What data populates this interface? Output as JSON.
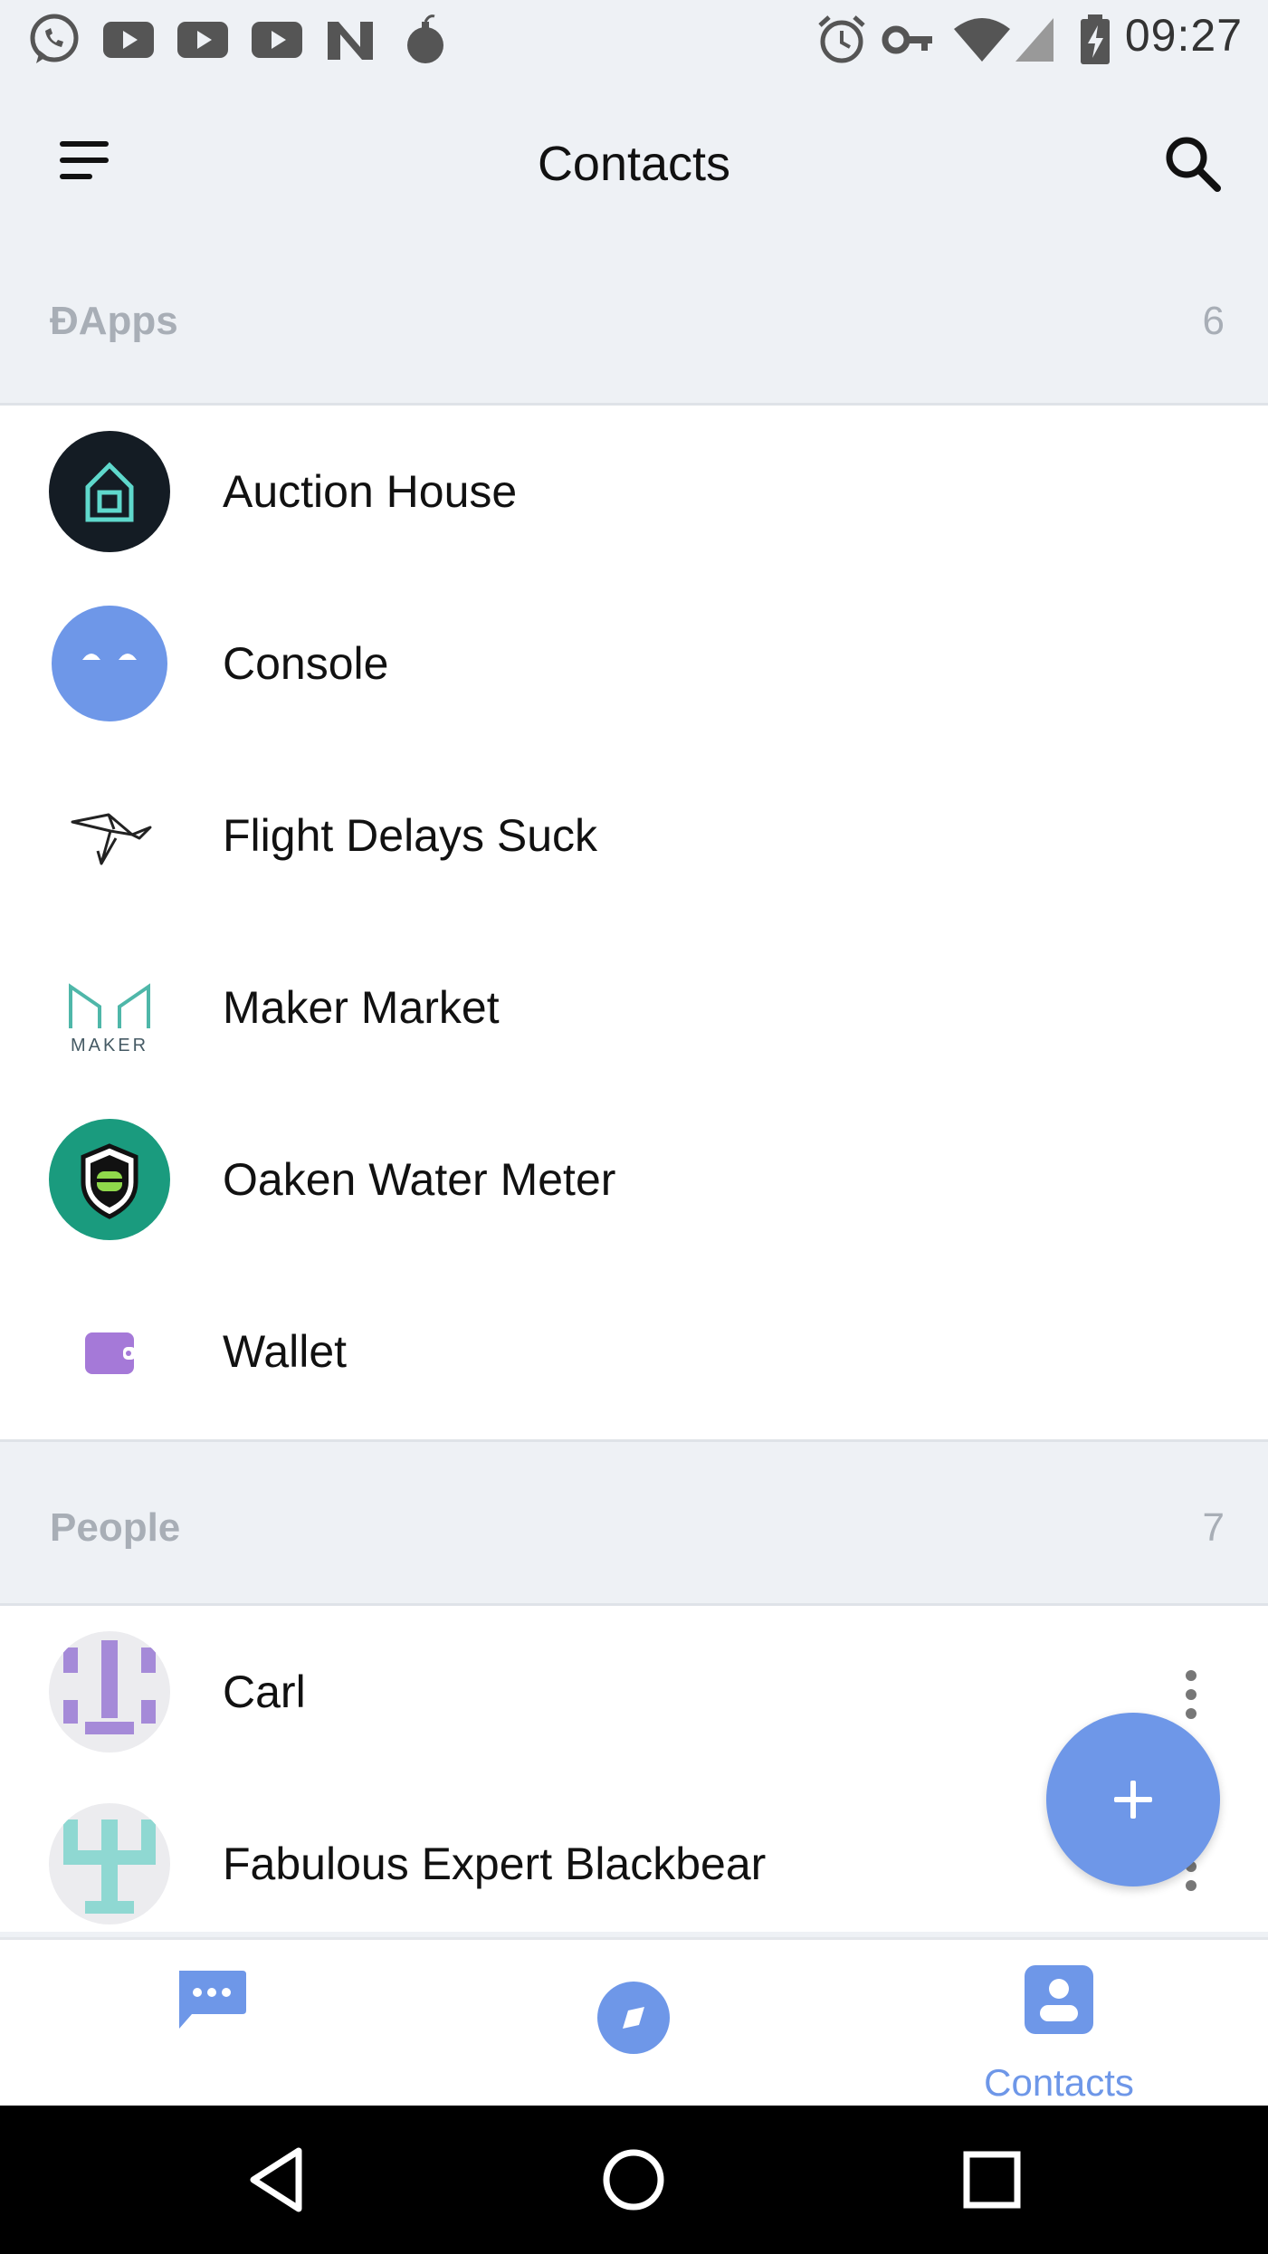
{
  "status_bar": {
    "time": "09:27",
    "left_icons": [
      "whatsapp-icon",
      "youtube-icon",
      "youtube-icon",
      "youtube-icon",
      "n-app-icon",
      "bomb-icon"
    ],
    "right_icons": [
      "alarm-icon",
      "key-icon",
      "wifi-icon",
      "signal-icon",
      "battery-charging-icon"
    ]
  },
  "toolbar": {
    "title": "Contacts"
  },
  "dapps": {
    "label": "ĐApps",
    "count": "6",
    "items": [
      {
        "name": "Auction House",
        "icon": "auction-house-icon"
      },
      {
        "name": "Console",
        "icon": "console-icon"
      },
      {
        "name": "Flight Delays Suck",
        "icon": "bird-icon"
      },
      {
        "name": "Maker Market",
        "icon": "maker-logo"
      },
      {
        "name": "Oaken Water Meter",
        "icon": "shield-meter-icon"
      },
      {
        "name": "Wallet",
        "icon": "wallet-icon"
      }
    ]
  },
  "people": {
    "label": "People",
    "count": "7",
    "items": [
      {
        "name": "Carl",
        "icon": "identicon-purple"
      },
      {
        "name": "Fabulous Expert Blackbear",
        "icon": "identicon-teal"
      }
    ]
  },
  "fab": {
    "icon": "plus-icon"
  },
  "tabs": [
    {
      "id": "chats",
      "icon": "chat-icon",
      "label": ""
    },
    {
      "id": "browse",
      "icon": "compass-icon",
      "label": ""
    },
    {
      "id": "contacts",
      "icon": "contacts-icon",
      "label": "Contacts"
    }
  ],
  "colors": {
    "accent": "#6e97e8",
    "header_bg": "#eef1f5",
    "section_label": "#a8aeb6",
    "maker_teal": "#4fb7a9",
    "oaken_green": "#1a9b7e",
    "wallet_purple": "#a579d8"
  }
}
